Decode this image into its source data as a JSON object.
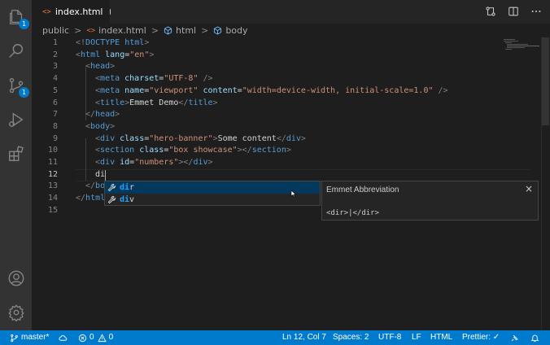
{
  "tab": {
    "icon": "<>",
    "label": "index.html"
  },
  "breadcrumb": {
    "folder": "public",
    "file": "index.html",
    "sym1": "html",
    "sym2": "body",
    "sep": ">"
  },
  "activity": {
    "explorer_badge": "1",
    "scm_badge": "1"
  },
  "lines": [
    {
      "n": "1"
    },
    {
      "n": "2"
    },
    {
      "n": "3"
    },
    {
      "n": "4"
    },
    {
      "n": "5"
    },
    {
      "n": "6"
    },
    {
      "n": "7"
    },
    {
      "n": "8"
    },
    {
      "n": "9"
    },
    {
      "n": "10"
    },
    {
      "n": "11"
    },
    {
      "n": "12"
    },
    {
      "n": "13"
    },
    {
      "n": "14"
    },
    {
      "n": "15"
    }
  ],
  "code": {
    "l1": {
      "a": "<!",
      "b": "DOCTYPE",
      "c": " html",
      "d": ">"
    },
    "l2": {
      "a": "<",
      "b": "html",
      "c": " lang",
      "d": "=",
      "e": "\"en\"",
      "f": ">"
    },
    "l3": {
      "a": "<",
      "b": "head",
      "c": ">"
    },
    "l4": {
      "a": "<",
      "b": "meta",
      "c": " charset",
      "d": "=",
      "e": "\"UTF-8\"",
      "f": " />"
    },
    "l5": {
      "a": "<",
      "b": "meta",
      "c": " name",
      "d": "=",
      "e": "\"viewport\"",
      "f": " content",
      "g": "=",
      "h": "\"width=device-width, initial-scale=1.0\"",
      "i": " />"
    },
    "l6": {
      "a": "<",
      "b": "title",
      "c": ">",
      "d": "Emmet Demo",
      "e": "</",
      "f": "title",
      "g": ">"
    },
    "l7": {
      "a": "</",
      "b": "head",
      "c": ">"
    },
    "l8": {
      "a": "<",
      "b": "body",
      "c": ">"
    },
    "l9": {
      "a": "<",
      "b": "div",
      "c": " class",
      "d": "=",
      "e": "\"hero-banner\"",
      "f": ">",
      "g": "Some content",
      "h": "</",
      "i": "div",
      "j": ">"
    },
    "l10": {
      "a": "<",
      "b": "section",
      "c": " class",
      "d": "=",
      "e": "\"box showcase\"",
      "f": "></",
      "g": "section",
      "h": ">"
    },
    "l11": {
      "a": "<",
      "b": "div",
      "c": " id",
      "d": "=",
      "e": "\"numbers\"",
      "f": "></",
      "g": "div",
      "h": ">"
    },
    "l12": {
      "a": "di"
    },
    "l13": {
      "a": "</",
      "b": "bo"
    },
    "l14": {
      "a": "</",
      "b": "html"
    }
  },
  "suggest": {
    "items": [
      {
        "match": "di",
        "rest": "r"
      },
      {
        "match": "di",
        "rest": "v"
      }
    ]
  },
  "details": {
    "title": "Emmet Abbreviation",
    "close": "×",
    "body": "<dir>|</dir>"
  },
  "status": {
    "branch": "master*",
    "errors": "0",
    "warnings": "0",
    "position": "Ln 12, Col 7",
    "spaces": "Spaces: 2",
    "encoding": "UTF-8",
    "eol": "LF",
    "language": "HTML",
    "prettier": "Prettier: ✓"
  },
  "colors": {
    "accent": "#007acc",
    "tag": "#569cd6",
    "attr": "#9cdcfe",
    "string": "#ce9178",
    "match": "#18a3ff"
  }
}
